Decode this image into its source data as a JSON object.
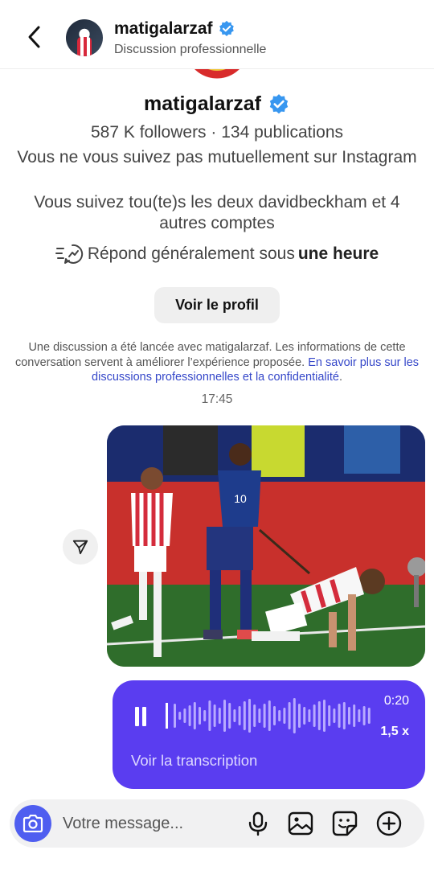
{
  "header": {
    "username": "matigalarzaf",
    "subtitle": "Discussion professionnelle"
  },
  "profile": {
    "name": "matigalarzaf",
    "stats": "587 K followers · 134 publications",
    "mutual": "Vous ne vous suivez pas mutuellement sur Instagram",
    "follows": "Vous suivez tou(te)s les deux davidbeckham et 4 autres comptes",
    "responds_prefix": "Répond généralement sous",
    "responds_time": "une heure",
    "view_profile_label": "Voir le profil"
  },
  "disclaimer": {
    "text": "Une discussion a été lancée avec matigalarzaf. Les informations de cette conversation servent à améliorer l’expérience proposée.",
    "link": "En savoir plus sur les discussions professionnelles et la confidentialité",
    "end": "."
  },
  "timestamp": "17:45",
  "image_message": {
    "jersey_number": "10"
  },
  "voice_message": {
    "duration": "0:20",
    "speed": "1,5 x",
    "transcript_label": "Voir la transcription"
  },
  "composer": {
    "placeholder": "Votre message..."
  },
  "colors": {
    "accent": "#5a3df0",
    "camera": "#4f5ef0",
    "link": "#3547c9",
    "verified": "#3897f0"
  },
  "icons": [
    "back-arrow-icon",
    "verified-badge-icon",
    "quick-reply-icon",
    "share-icon",
    "pause-icon",
    "camera-icon",
    "microphone-icon",
    "gallery-icon",
    "sticker-icon",
    "plus-icon"
  ]
}
